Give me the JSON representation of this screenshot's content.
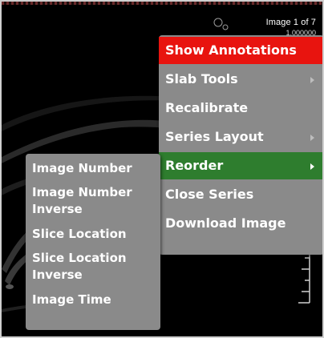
{
  "viewer": {
    "image_counter": "Image 1 of 7",
    "image_subtext": "1.000000"
  },
  "context_menu": {
    "items": [
      {
        "label": "Show Annotations",
        "state": "highlighted",
        "has_submenu": false
      },
      {
        "label": "Slab Tools",
        "has_submenu": true
      },
      {
        "label": "Recalibrate",
        "has_submenu": false
      },
      {
        "label": "Series Layout",
        "has_submenu": true
      },
      {
        "label": "Reorder",
        "state": "active",
        "has_submenu": true
      },
      {
        "label": "Close Series",
        "has_submenu": false
      },
      {
        "label": "Download Image",
        "has_submenu": false
      }
    ]
  },
  "reorder_submenu": {
    "items": [
      {
        "label": "Image Number"
      },
      {
        "label": "Image Number Inverse"
      },
      {
        "label": "Slice Location"
      },
      {
        "label": "Slice Location Inverse"
      },
      {
        "label": "Image Time"
      }
    ]
  },
  "colors": {
    "highlight": "#e8140f",
    "active": "#2e7d2e",
    "menu_bg": "#8a8a8a",
    "viewer_bg": "#000000"
  }
}
